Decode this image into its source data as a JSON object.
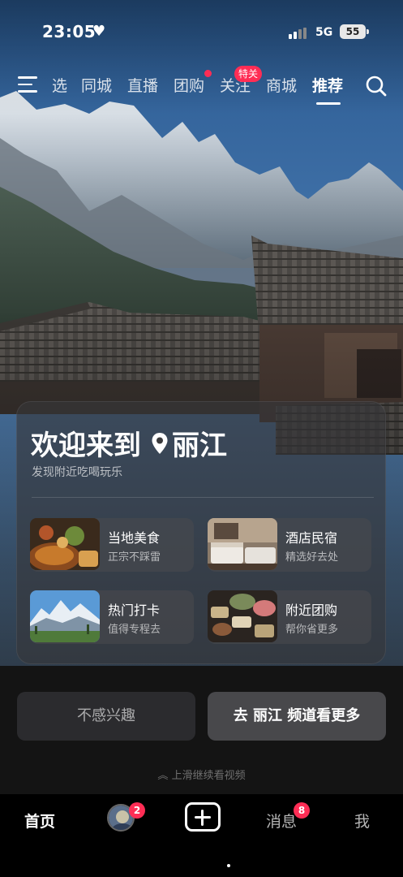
{
  "status_bar": {
    "time": "23:05",
    "network": "5G",
    "battery": "55"
  },
  "top_nav": {
    "tabs": [
      "选",
      "同城",
      "直播",
      "团购",
      "关注",
      "商城",
      "推荐"
    ],
    "active_tab": "推荐",
    "follow_badge": "特关",
    "accent_color": "#ff2d55"
  },
  "welcome_card": {
    "title_prefix": "欢迎来到",
    "city": "丽江",
    "subtitle": "发现附近吃喝玩乐",
    "tiles": [
      {
        "title": "当地美食",
        "subtitle": "正宗不踩雷",
        "icon": "food-thumbnail"
      },
      {
        "title": "酒店民宿",
        "subtitle": "精选好去处",
        "icon": "hotel-thumbnail"
      },
      {
        "title": "热门打卡",
        "subtitle": "值得专程去",
        "icon": "snow-mountain-thumbnail"
      },
      {
        "title": "附近团购",
        "subtitle": "帮你省更多",
        "icon": "group-buy-thumbnail"
      }
    ]
  },
  "actions": {
    "not_interested": "不感兴趣",
    "go_channel": "去 丽江 频道看更多"
  },
  "swipe_hint": "上滑继续看视频",
  "bottom_bar": {
    "home": "首页",
    "friend_badge": "2",
    "messages": "消息",
    "messages_badge": "8",
    "me": "我"
  }
}
